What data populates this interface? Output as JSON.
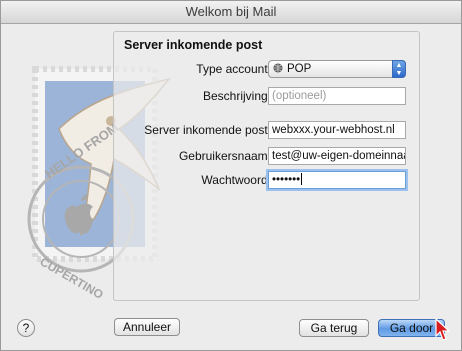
{
  "window": {
    "title": "Welkom bij Mail"
  },
  "stamp": {
    "text_top": "HELLO FROM",
    "text_bottom": "CUPERTINO"
  },
  "panel": {
    "title": "Server inkomende post",
    "type_account": {
      "label": "Type account:",
      "value": "POP",
      "icon": "globe-icon"
    },
    "description": {
      "label": "Beschrijving:",
      "placeholder": "(optioneel)"
    },
    "incoming_server": {
      "label": "Server inkomende post:",
      "value": "webxxx.your-webhost.nl"
    },
    "username": {
      "label": "Gebruikersnaam:",
      "value": "test@uw-eigen-domeinnaa"
    },
    "password": {
      "label": "Wachtwoord:",
      "value": "•••••••"
    }
  },
  "buttons": {
    "help": "?",
    "cancel": "Annuleer",
    "back": "Ga terug",
    "next": "Ga door"
  },
  "colors": {
    "accent": "#5e9be4",
    "focus_ring": "#9cc1ee"
  }
}
